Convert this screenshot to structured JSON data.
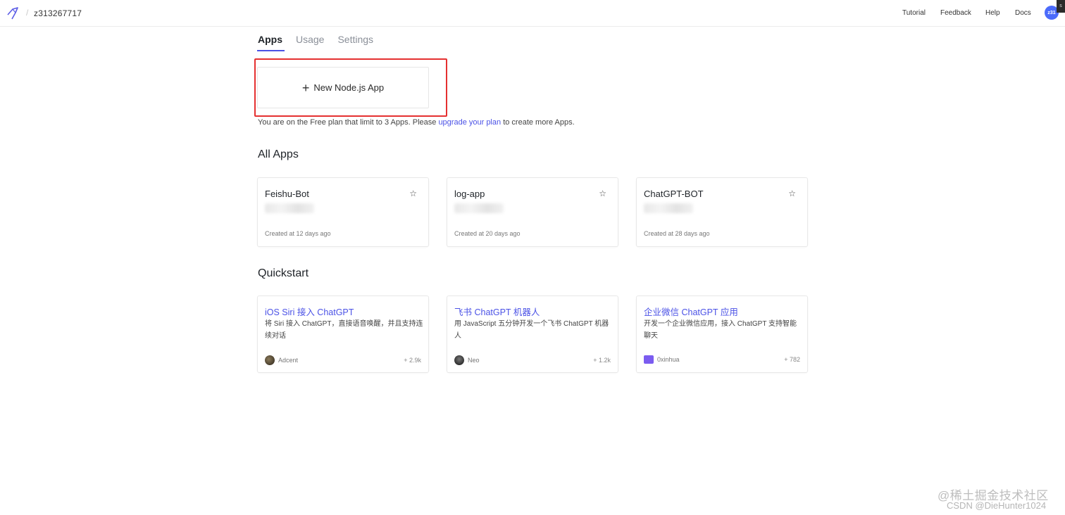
{
  "topbar": {
    "workspace": "z313267717",
    "separator": "/",
    "links": {
      "tutorial": "Tutorial",
      "feedback": "Feedback",
      "help": "Help",
      "docs": "Docs"
    },
    "avatar_label": "z31",
    "corner_glyph": "s"
  },
  "tabs": [
    {
      "label": "Apps",
      "active": true
    },
    {
      "label": "Usage",
      "active": false
    },
    {
      "label": "Settings",
      "active": false
    }
  ],
  "new_app": {
    "icon": "plus-icon",
    "label": "New Node.js App"
  },
  "plan_note": {
    "prefix": "You are on the Free plan that limit to 3 Apps. Please",
    "link": "upgrade your plan",
    "suffix": "to create more Apps."
  },
  "all_apps": {
    "title": "All Apps",
    "items": [
      {
        "name": "Feishu-Bot",
        "created": "Created at 12 days ago"
      },
      {
        "name": "log-app",
        "created": "Created at 20 days ago"
      },
      {
        "name": "ChatGPT-BOT",
        "created": "Created at 28 days ago"
      }
    ]
  },
  "quickstart": {
    "title": "Quickstart",
    "items": [
      {
        "title": "iOS Siri 接入 ChatGPT",
        "desc": "将 Siri 接入 ChatGPT，直接语音唤醒，并且支持连续对话",
        "author": "Adcent",
        "count": "+ 2.9k"
      },
      {
        "title": "飞书 ChatGPT 机器人",
        "desc": "用 JavaScript 五分钟开发一个飞书 ChatGPT 机器人",
        "author": "Neo",
        "count": "+ 1.2k"
      },
      {
        "title": "企业微信 ChatGPT 应用",
        "desc": "开发一个企业微信应用，接入 ChatGPT 支持智能聊天",
        "author": "0xinhua",
        "count": "+ 782"
      }
    ]
  },
  "watermark": {
    "line1": "@稀土掘金技术社区",
    "line2": "CSDN @DieHunter1024"
  },
  "colors": {
    "accent": "#4b52e6",
    "highlight": "#e53030"
  }
}
